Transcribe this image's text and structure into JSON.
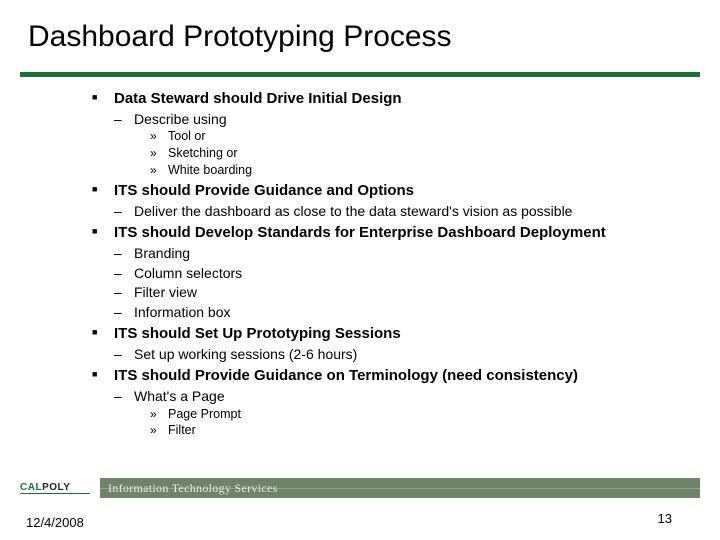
{
  "title": "Dashboard Prototyping Process",
  "bullets": {
    "b1": "Data Steward should Drive Initial Design",
    "b1_1": "Describe using",
    "b1_1_1": "Tool or",
    "b1_1_2": "Sketching  or",
    "b1_1_3": "White boarding",
    "b2": "ITS should Provide Guidance and Options",
    "b2_1": "Deliver the dashboard as close to the data steward's vision as possible",
    "b3": "ITS should Develop Standards for Enterprise Dashboard Deployment",
    "b3_1": "Branding",
    "b3_2": "Column selectors",
    "b3_3": "Filter view",
    "b3_4": "Information box",
    "b4": "ITS should Set Up Prototyping Sessions",
    "b4_1": "Set up working sessions (2-6 hours)",
    "b5": "ITS should Provide Guidance on Terminology (need consistency)",
    "b5_1": "What's a Page",
    "b5_1_1": "Page Prompt",
    "b5_1_2": "Filter"
  },
  "footer": {
    "logo_cal": "CAL",
    "logo_poly": "POLY",
    "its_label": "Information Technology Services",
    "date": "12/4/2008",
    "page": "13"
  }
}
